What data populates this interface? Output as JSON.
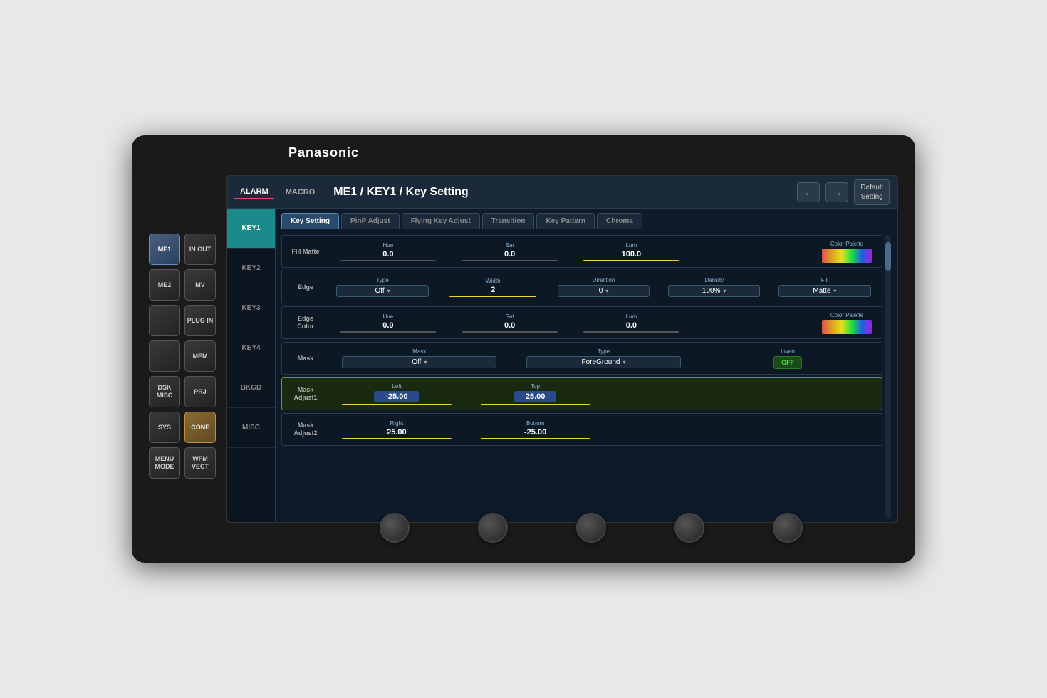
{
  "brand": "Panasonic",
  "topbar": {
    "alarm": "ALARM",
    "macro": "MACRO",
    "title": "ME1 / KEY1 / Key Setting",
    "default_setting": "Default\nSetting",
    "nav_back": "←",
    "nav_forward": "→"
  },
  "tabs": [
    {
      "label": "Key Setting",
      "active": true
    },
    {
      "label": "PinP Adjust",
      "active": false
    },
    {
      "label": "Flying Key Adjust",
      "active": false
    },
    {
      "label": "Transition",
      "active": false
    },
    {
      "label": "Key Pattern",
      "active": false
    },
    {
      "label": "Chroma",
      "active": false
    }
  ],
  "sidebar": [
    {
      "label": "KEY1",
      "active": true
    },
    {
      "label": "KEY2",
      "active": false
    },
    {
      "label": "KEY3",
      "active": false
    },
    {
      "label": "KEY4",
      "active": false
    },
    {
      "label": "BKGD",
      "active": false
    },
    {
      "label": "MISC",
      "active": false
    }
  ],
  "rows": [
    {
      "id": "fill-matte",
      "label": "Fill Matte",
      "params": [
        {
          "label": "Hue",
          "value": "0.0",
          "slider": true
        },
        {
          "label": "Sat",
          "value": "0.0",
          "slider": true
        },
        {
          "label": "Lum",
          "value": "100.0",
          "slider": true,
          "slider_color": "yellow"
        }
      ],
      "right": "color_palette"
    },
    {
      "id": "edge",
      "label": "Edge",
      "params": [
        {
          "label": "Type",
          "value": "Off",
          "dropdown": true
        },
        {
          "label": "Width",
          "value": "2",
          "slider": true
        },
        {
          "label": "Direction",
          "value": "0",
          "dropdown": true
        },
        {
          "label": "Density",
          "value": "100%",
          "dropdown": true
        },
        {
          "label": "Fill",
          "value": "Matte",
          "dropdown": true
        }
      ]
    },
    {
      "id": "edge-color",
      "label": "Edge\nColor",
      "params": [
        {
          "label": "Hue",
          "value": "0.0",
          "slider": true
        },
        {
          "label": "Sat",
          "value": "0.0",
          "slider": true
        },
        {
          "label": "Lum",
          "value": "0.0",
          "slider": true
        }
      ],
      "right": "color_palette"
    },
    {
      "id": "mask",
      "label": "Mask",
      "params": [
        {
          "label": "Mask",
          "value": "Off",
          "dropdown": true
        },
        {
          "label": "Type",
          "value": "ForeGround",
          "dropdown": true
        },
        {
          "label": "Invert",
          "value": "OFF",
          "toggle": true
        }
      ]
    },
    {
      "id": "mask-adjust1",
      "label": "Mask\nAdjust1",
      "highlighted": true,
      "params": [
        {
          "label": "Left",
          "value": "-25.00",
          "highlight": true
        },
        {
          "label": "Top",
          "value": "25.00",
          "highlight": true
        }
      ]
    },
    {
      "id": "mask-adjust2",
      "label": "Mask\nAdjust2",
      "params": [
        {
          "label": "Right",
          "value": "25.00",
          "slider": true
        },
        {
          "label": "Bottom",
          "value": "-25.00",
          "slider": true
        }
      ]
    }
  ],
  "hw_buttons": [
    [
      {
        "label": "ME1",
        "style": "active-blue"
      },
      {
        "label": "IN\nOUT",
        "style": "normal"
      }
    ],
    [
      {
        "label": "ME2",
        "style": "normal"
      },
      {
        "label": "MV",
        "style": "normal"
      }
    ],
    [
      {
        "label": "",
        "style": "normal"
      },
      {
        "label": "PLUG\nIN",
        "style": "normal"
      }
    ],
    [
      {
        "label": "",
        "style": "normal"
      },
      {
        "label": "MEM",
        "style": "normal"
      }
    ],
    [
      {
        "label": "DSK\nMISC",
        "style": "normal"
      },
      {
        "label": "PRJ",
        "style": "normal"
      }
    ],
    [
      {
        "label": "SYS",
        "style": "normal"
      },
      {
        "label": "CONF",
        "style": "active-conf"
      }
    ],
    [
      {
        "label": "MENU\nMODE",
        "style": "normal"
      },
      {
        "label": "WFM\nVECT",
        "style": "normal"
      }
    ]
  ]
}
